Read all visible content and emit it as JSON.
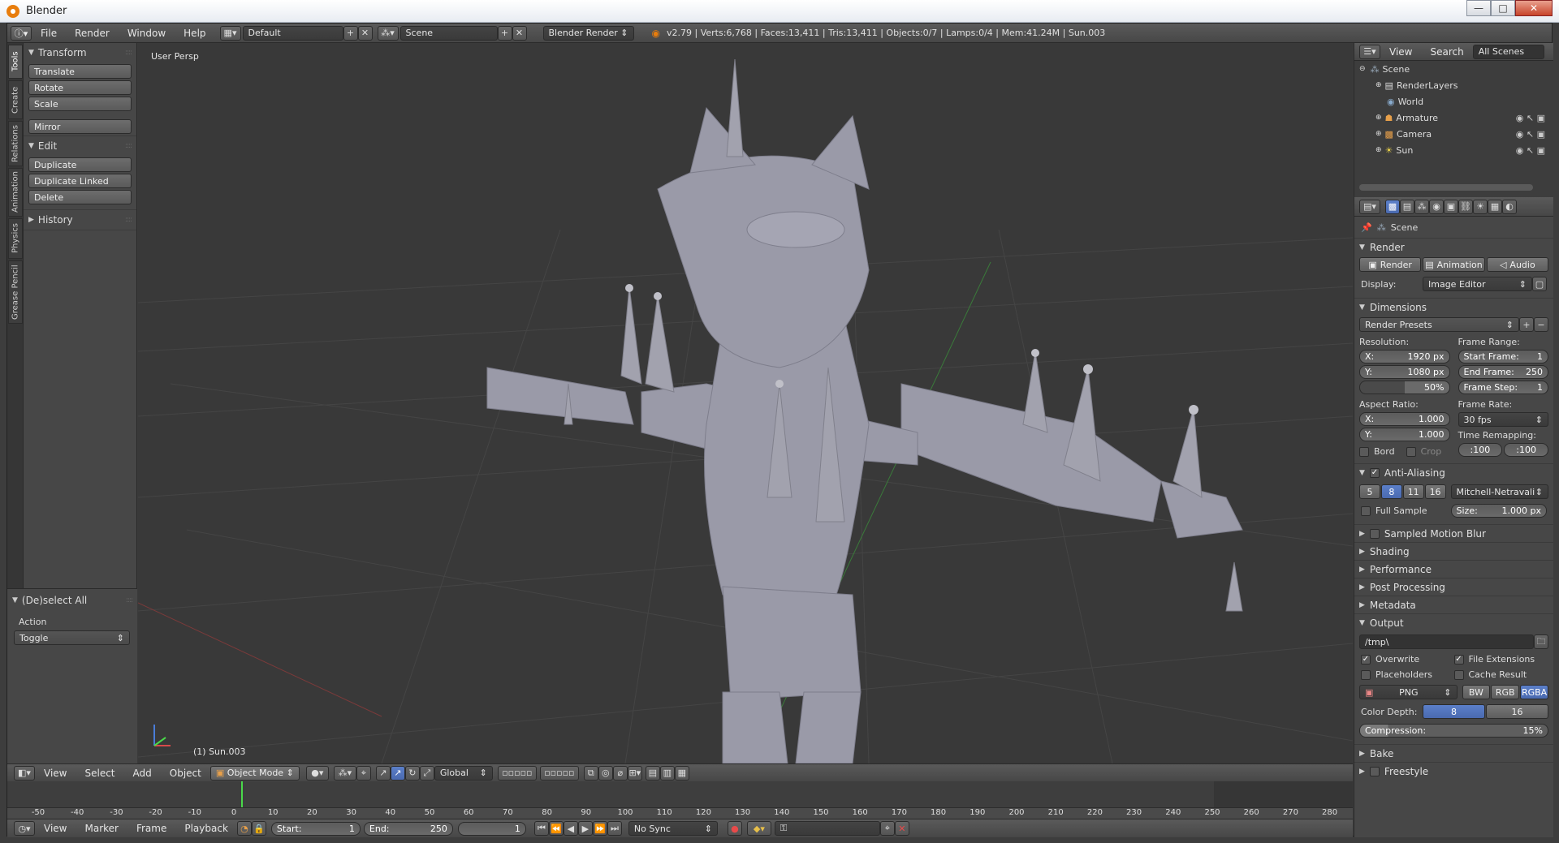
{
  "window": {
    "title": "Blender",
    "min": "—",
    "max": "□",
    "close": "✕"
  },
  "infobar": {
    "menus": [
      "File",
      "Render",
      "Window",
      "Help"
    ],
    "layout": "Default",
    "scene": "Scene",
    "engine": "Blender Render",
    "stats": "v2.79 | Verts:6,768 | Faces:13,411 | Tris:13,411 | Objects:0/7 | Lamps:0/4 | Mem:41.24M | Sun.003"
  },
  "left_tabs": [
    "Tools",
    "Create",
    "Relations",
    "Animation",
    "Physics",
    "Grease Pencil"
  ],
  "toolshelf": {
    "transform": {
      "title": "Transform",
      "buttons": [
        "Translate",
        "Rotate",
        "Scale"
      ],
      "mirror": "Mirror"
    },
    "edit": {
      "title": "Edit",
      "buttons": [
        "Duplicate",
        "Duplicate Linked",
        "Delete"
      ]
    },
    "history": "History",
    "operator": {
      "title": "(De)select All",
      "action_label": "Action",
      "action_value": "Toggle"
    }
  },
  "viewport": {
    "label": "User Persp",
    "object": "(1) Sun.003"
  },
  "view3d_header": {
    "menus": [
      "View",
      "Select",
      "Add",
      "Object"
    ],
    "mode": "Object Mode",
    "orientation": "Global"
  },
  "timeline": {
    "ticks": [
      "-50",
      "-40",
      "-30",
      "-20",
      "-10",
      "0",
      "10",
      "20",
      "30",
      "40",
      "50",
      "60",
      "70",
      "80",
      "90",
      "100",
      "110",
      "120",
      "130",
      "140",
      "150",
      "160",
      "170",
      "180",
      "190",
      "200",
      "210",
      "220",
      "230",
      "240",
      "250",
      "260",
      "270",
      "280"
    ],
    "menus": [
      "View",
      "Marker",
      "Frame",
      "Playback"
    ],
    "start_label": "Start:",
    "start": "1",
    "end_label": "End:",
    "end": "250",
    "current": "1",
    "sync": "No Sync"
  },
  "outliner": {
    "menus": [
      "View",
      "Search"
    ],
    "filter": "All Scenes",
    "items": [
      "Scene",
      "RenderLayers",
      "World",
      "Armature",
      "Camera",
      "Sun"
    ]
  },
  "properties": {
    "context": "Scene",
    "render": {
      "title": "Render",
      "buttons": [
        "Render",
        "Animation",
        "Audio"
      ],
      "display_label": "Display:",
      "display_value": "Image Editor"
    },
    "dimensions": {
      "title": "Dimensions",
      "presets": "Render Presets",
      "resolution_label": "Resolution:",
      "res_x": "X:",
      "res_x_val": "1920 px",
      "res_y": "Y:",
      "res_y_val": "1080 px",
      "res_pct": "50%",
      "frame_range_label": "Frame Range:",
      "start_frame": "Start Frame:",
      "start_frame_val": "1",
      "end_frame": "End Frame:",
      "end_frame_val": "250",
      "frame_step": "Frame Step:",
      "frame_step_val": "1",
      "aspect_label": "Aspect Ratio:",
      "asp_x": "X:",
      "asp_x_val": "1.000",
      "asp_y": "Y:",
      "asp_y_val": "1.000",
      "frame_rate_label": "Frame Rate:",
      "frame_rate_val": "30 fps",
      "time_remap_label": "Time Remapping:",
      "remap_old": ":100",
      "remap_new": ":100",
      "bord": "Bord",
      "crop": "Crop"
    },
    "anti_aliasing": {
      "title": "Anti-Aliasing",
      "samples": [
        "5",
        "8",
        "11",
        "16"
      ],
      "filter": "Mitchell-Netravali",
      "full_sample": "Full Sample",
      "size_label": "Size:",
      "size_val": "1.000 px"
    },
    "collapsed": [
      "Sampled Motion Blur",
      "Shading",
      "Performance",
      "Post Processing",
      "Metadata"
    ],
    "output": {
      "title": "Output",
      "path": "/tmp\\",
      "overwrite": "Overwrite",
      "file_ext": "File Extensions",
      "placeholders": "Placeholders",
      "cache": "Cache Result",
      "format": "PNG",
      "color_modes": [
        "BW",
        "RGB",
        "RGBA"
      ],
      "depth_label": "Color Depth:",
      "depths": [
        "8",
        "16"
      ],
      "compression_label": "Compression:",
      "compression_val": "15%"
    },
    "bake": "Bake",
    "freestyle": "Freestyle"
  },
  "colors": {
    "accent_blue": "#5b7fc9",
    "orange": "#e87d0d",
    "grid": "#4a4a4a",
    "mesh": "#9a9aa8"
  }
}
